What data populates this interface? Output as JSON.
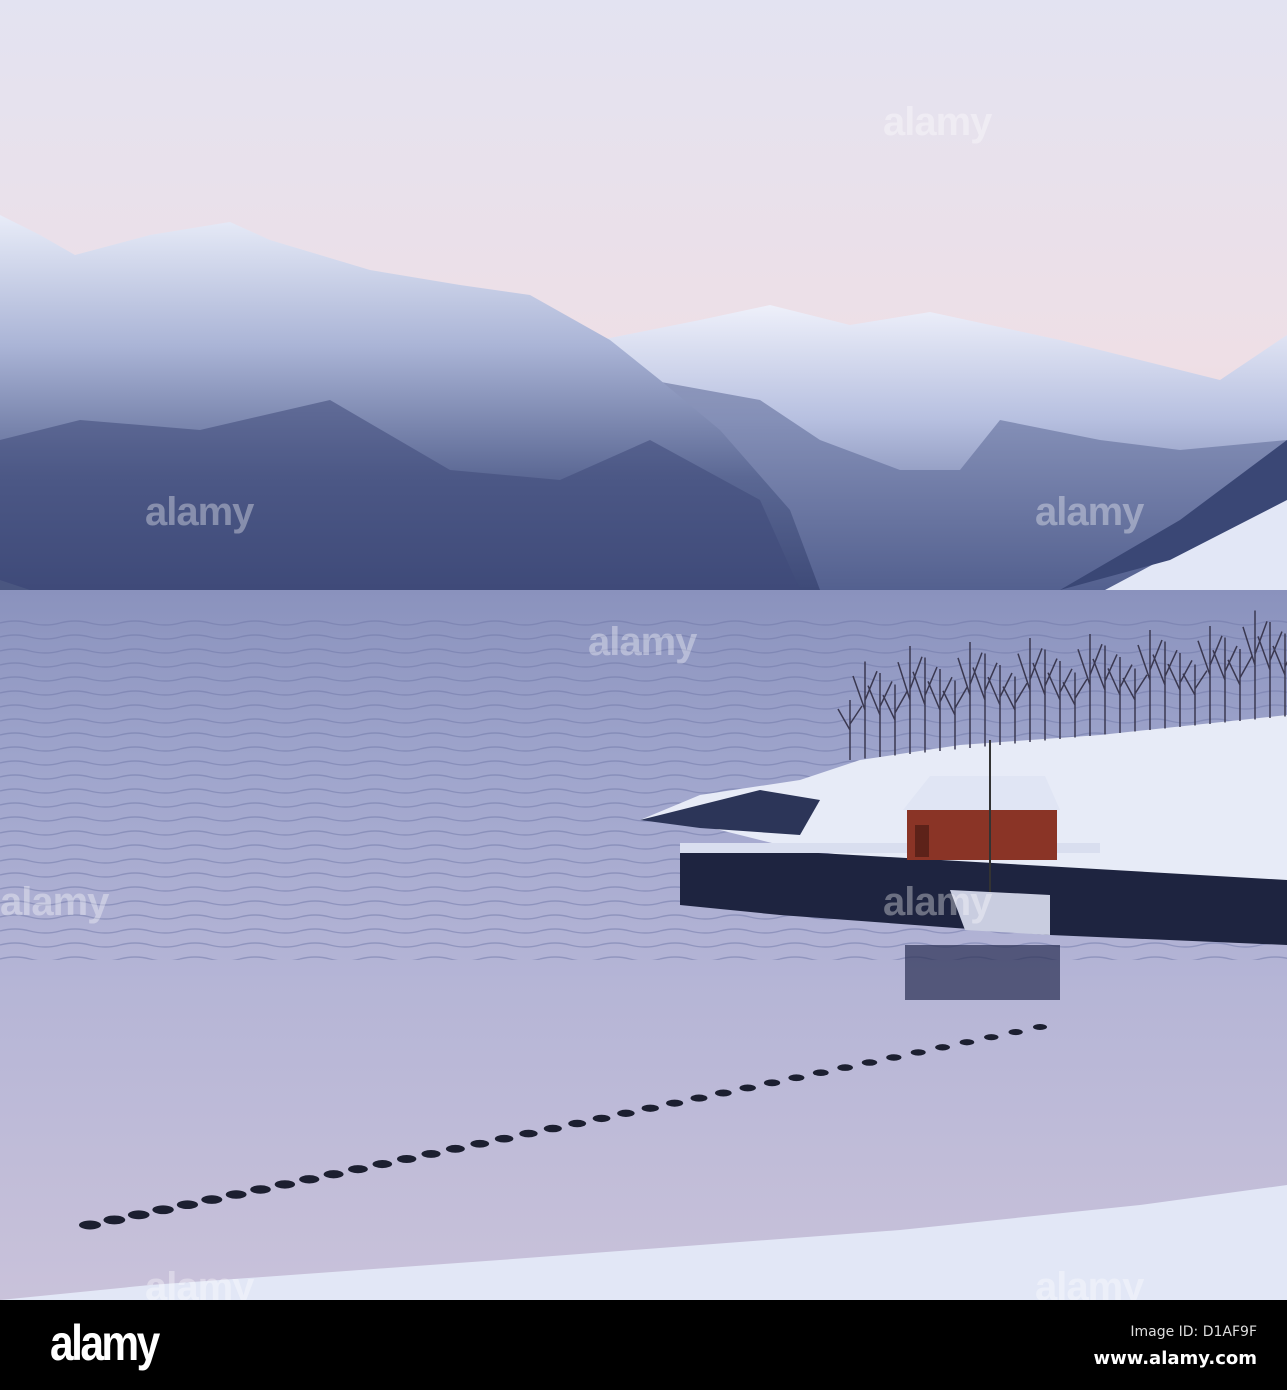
{
  "photo": {
    "subject": "Snow-covered fjord with mountains, red boathouse and line of buoys at dusk",
    "watermark_text": "alamy"
  },
  "footer": {
    "logo": "alamy",
    "image_id": "Image ID: D1AF9F",
    "website": "www.alamy.com"
  },
  "colors": {
    "sky_top": "#e6e6f2",
    "sky_bottom": "#f2d8d6",
    "mountain": "#5a6a94",
    "water": "#a9b0d0",
    "snow": "#e4e9f7",
    "boathouse": "#8a3426"
  }
}
